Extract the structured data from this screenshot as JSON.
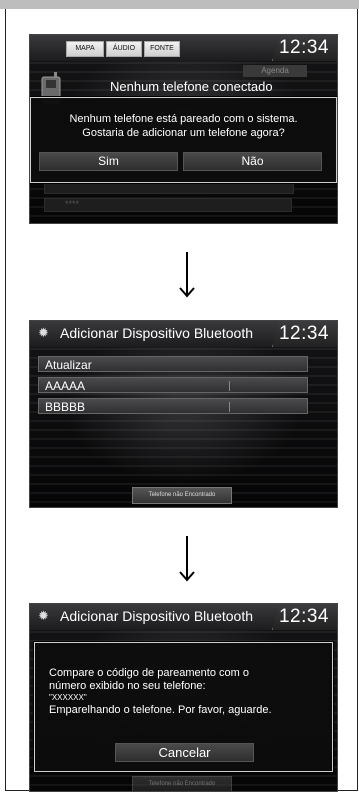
{
  "screen1": {
    "clock": "12:34",
    "tabs": [
      "MAPA",
      "ÁUDIO",
      "FONTE"
    ],
    "agenda": "Agenda",
    "heading": "Nenhum telefone conectado",
    "dialog_line1": "Nenhum telefone está pareado com o sistema.",
    "dialog_line2": "Gostaria de adicionar um telefone agora?",
    "yes": "Sim",
    "no": "Não",
    "ghost_item": "****"
  },
  "screen2": {
    "title": "Adicionar Dispositivo Bluetooth",
    "clock": "12:34",
    "items": [
      "Atualizar",
      "AAAAA",
      "BBBBB"
    ],
    "not_found": "Telefone não Encontrado"
  },
  "screen3": {
    "title": "Adicionar Dispositivo Bluetooth",
    "clock": "12:34",
    "line1": "Compare o código de pareamento com o",
    "line2": "número exibido no seu telefone:",
    "code": "\"XXXXXX\"",
    "line3": "Emparelhando o telefone. Por favor, aguarde.",
    "cancel": "Cancelar",
    "not_found": "Telefone não Encontrado"
  }
}
